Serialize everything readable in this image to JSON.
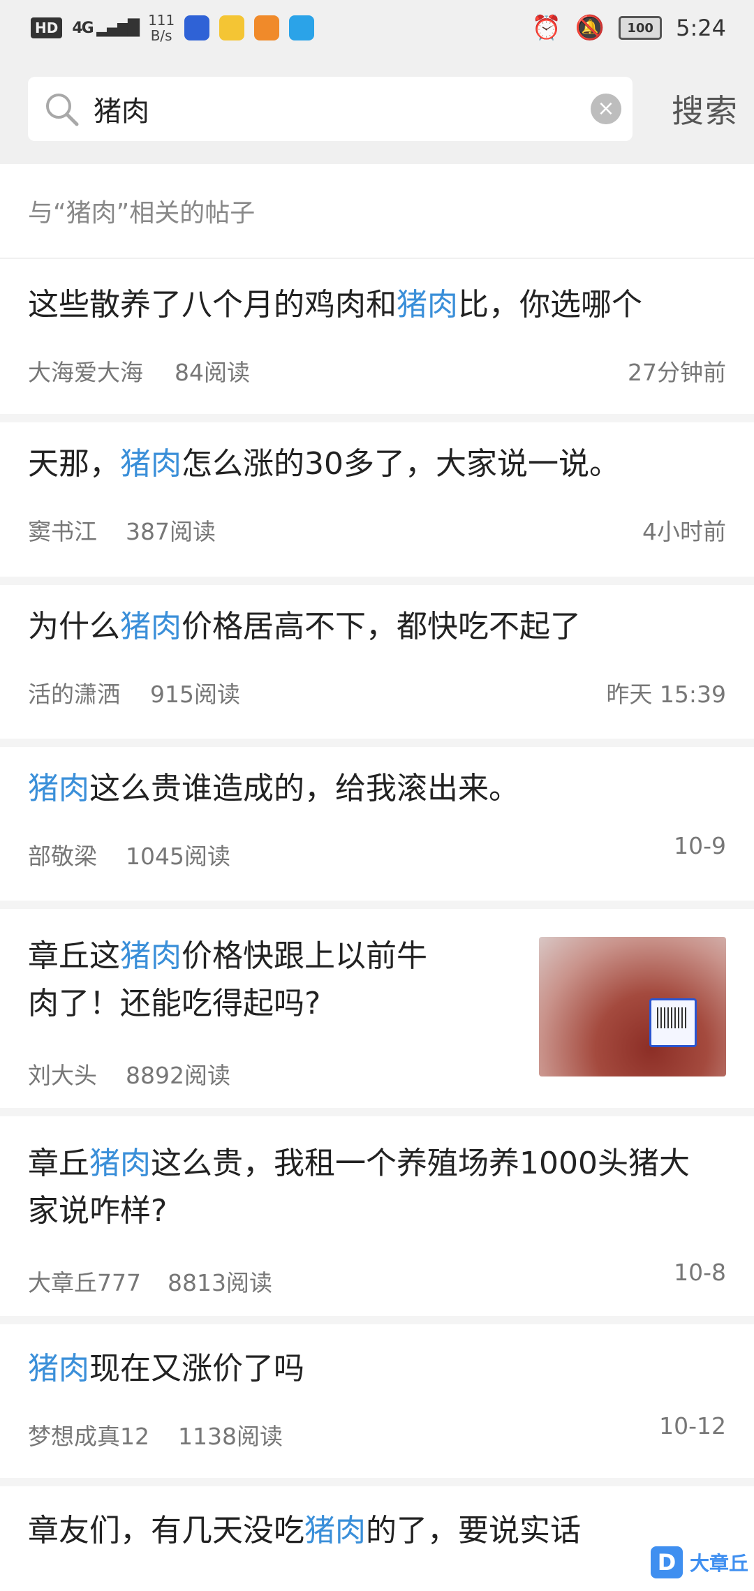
{
  "status_bar": {
    "network_label": "HD",
    "signal_label": "4G",
    "speed_value": "111",
    "speed_unit": "B/s",
    "battery": "100",
    "time": "5:24"
  },
  "search": {
    "query": "猪肉",
    "button_label": "搜索"
  },
  "section_header": "与“猪肉”相关的帖子",
  "posts": [
    {
      "title_before": "这些散养了八个月的鸡肉和",
      "title_highlight": "猪肉",
      "title_after": "比，你选哪个",
      "author": "大海爱大海",
      "reads": "84阅读",
      "time": "27分钟前"
    },
    {
      "title_before": "天那，",
      "title_highlight": "猪肉",
      "title_after": "怎么涨的30多了，大家说一说。",
      "author": "窦书江",
      "reads": "387阅读",
      "time": "4小时前"
    },
    {
      "title_before": "为什么",
      "title_highlight": "猪肉",
      "title_after": "价格居高不下，都快吃不起了",
      "author": "活的潇洒",
      "reads": "915阅读",
      "time": "昨天 15:39"
    },
    {
      "title_before": "",
      "title_highlight": "猪肉",
      "title_after": "这么贵谁造成的，给我滚出来。",
      "author": "部敬梁",
      "reads": "1045阅读",
      "time": "10-9"
    },
    {
      "title_line1_before": "章丘这",
      "title_highlight": "猪肉",
      "title_line1_after": "价格快跟上以前牛",
      "title_line2": "肉了！还能吃得起吗?",
      "author": "刘大头",
      "reads": "8892阅读",
      "time": ""
    },
    {
      "title_line1_before": "章丘",
      "title_highlight": "猪肉",
      "title_line1_after": "这么贵，我租一个养殖场养1000头猪大",
      "title_line2": "家说咋样?",
      "author": "大章丘777",
      "reads": "8813阅读",
      "time": "10-8"
    },
    {
      "title_before": "",
      "title_highlight": "猪肉",
      "title_after": "现在又涨价了吗",
      "author": "梦想成真12",
      "reads": "1138阅读",
      "time": "10-12"
    },
    {
      "title_before": "章友们，有几天没吃",
      "title_highlight": "猪肉",
      "title_after": "的了，要说实话",
      "author": "",
      "reads": "",
      "time": ""
    }
  ],
  "watermark": {
    "logo": "D",
    "text": "大章丘"
  },
  "colors": {
    "highlight": "#3a8fd9",
    "background_top": "#f0f0f0"
  }
}
